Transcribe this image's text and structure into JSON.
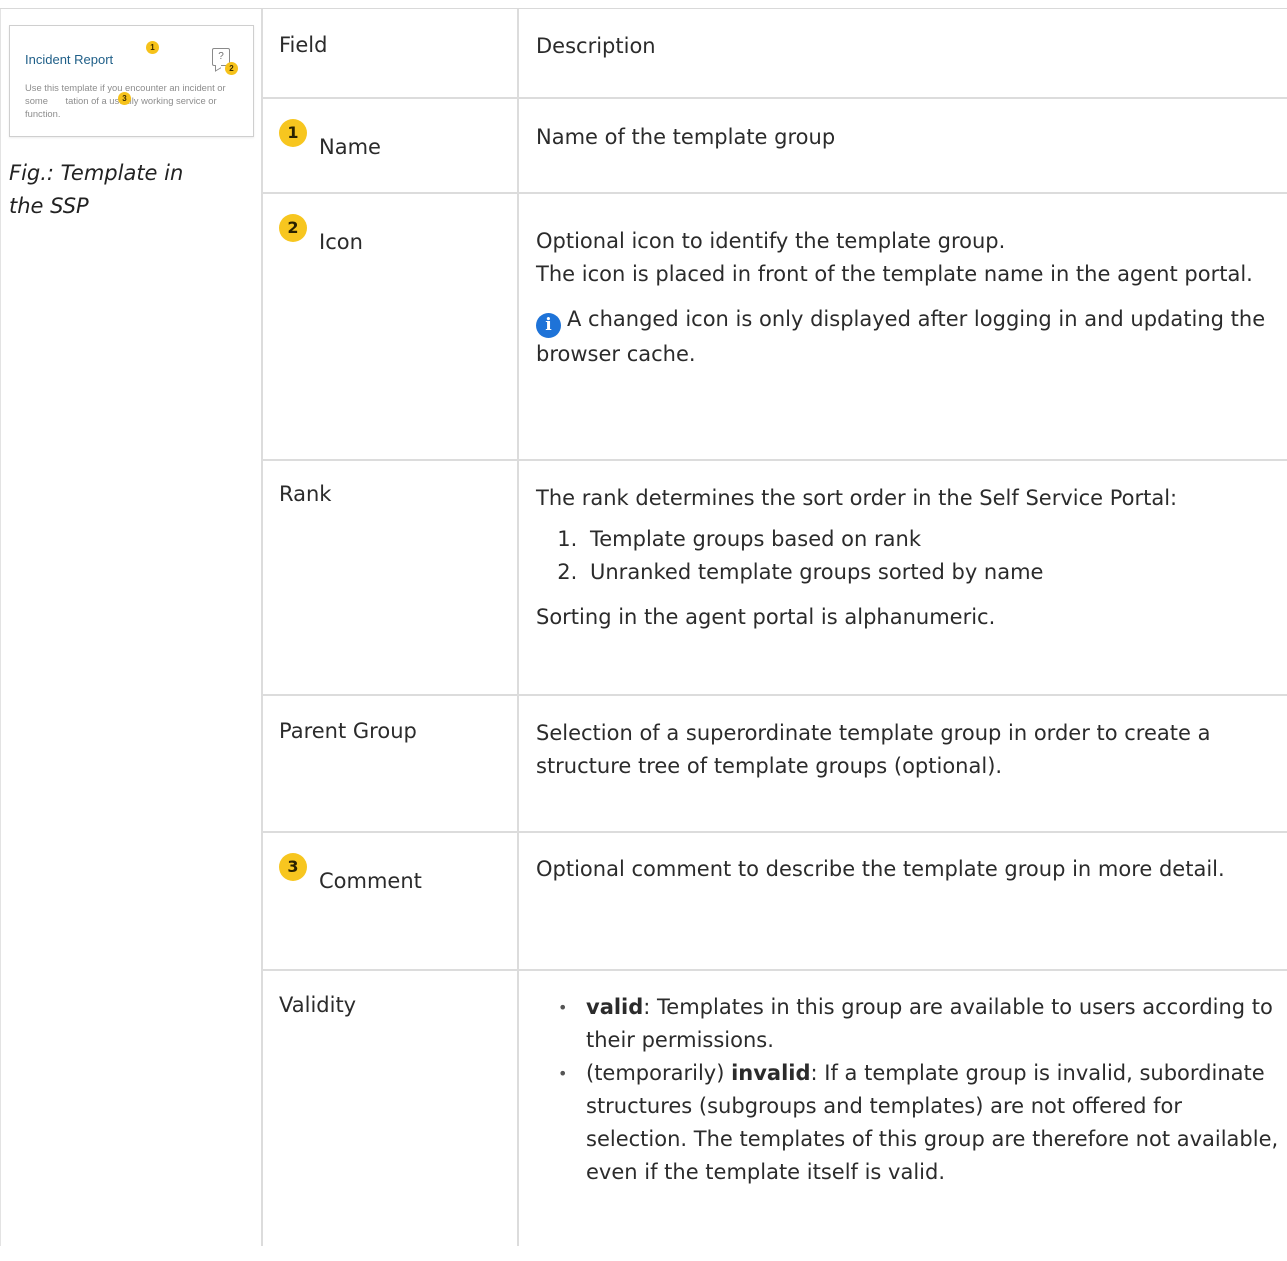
{
  "figure": {
    "thumbnail": {
      "title": "Incident Report",
      "badge_1": "1",
      "badge_2": "2",
      "badge_3": "3",
      "help_glyph": "?",
      "text_part1": "Use this template if you encounter an incident or some ",
      "text_part2": "tation of a usually working service or function."
    },
    "caption": "Fig.: Template in the SSP"
  },
  "table": {
    "header": {
      "field": "Field",
      "description": "Description"
    },
    "rows": {
      "name": {
        "badge": "1",
        "field": "Name",
        "description": "Name of the template group"
      },
      "icon": {
        "badge": "2",
        "field": "Icon",
        "desc_line1": "Optional icon to identify the template group.",
        "desc_line2": "The icon is placed in front of the template name in the agent portal.",
        "note": "A changed icon is only displayed after logging in and updating the browser cache."
      },
      "rank": {
        "field": "Rank",
        "desc_intro": "The rank determines the sort order in the Self Service Portal:",
        "list": [
          "Template groups based on rank",
          "Unranked template groups sorted by name"
        ],
        "desc_outro": "Sorting in the agent portal is alphanumeric."
      },
      "parent_group": {
        "field": "Parent Group",
        "description": "Selection of a superordinate template group in order to create a structure tree of template groups (optional)."
      },
      "comment": {
        "badge": "3",
        "field": "Comment",
        "description": "Optional comment to describe the template group in more detail."
      },
      "validity": {
        "field": "Validity",
        "item1_bold": "valid",
        "item1_text": ": Templates in this group are available to users according to their permissions.",
        "item2_prefix": "(temporarily) ",
        "item2_bold": "invalid",
        "item2_text": ": If a template group is invalid, subordinate structures (subgroups and templates) are not offered for selection. The templates of this group are therefore not available, even if the template itself is valid."
      }
    }
  },
  "colors": {
    "badge_yellow": "#f7c61f",
    "info_blue": "#1e73d8",
    "thumb_title_blue": "#1f5f88",
    "grid_line": "#dcdcdc"
  }
}
